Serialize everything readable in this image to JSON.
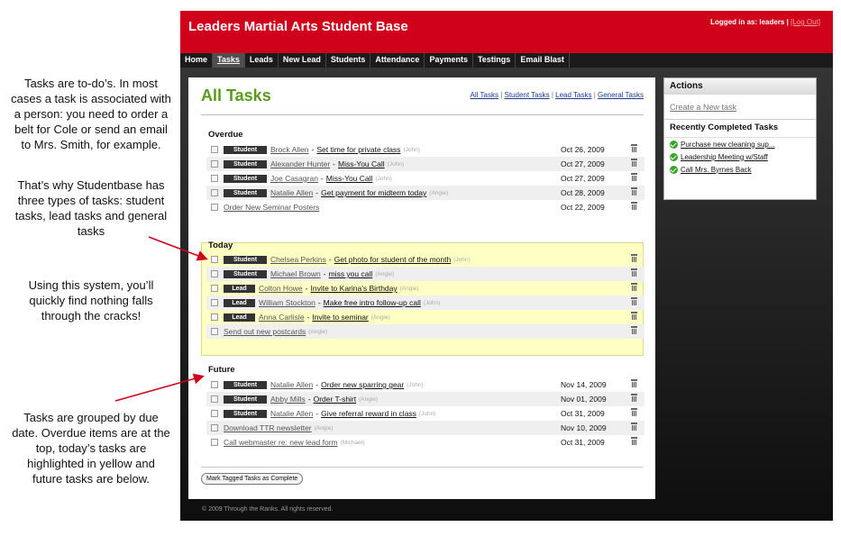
{
  "notes": [
    "Tasks are to-do’s.  In most cases a task is associated with a person:  you need to order a belt for Cole or send an email to Mrs. Smith, for example.",
    "That’s why Studentbase has three types of tasks: student tasks, lead tasks and general tasks",
    "Using this system, you’ll quickly find nothing falls through the cracks!",
    "Tasks are grouped by due date. Overdue items are at the top, today’s tasks are highlighted in yellow and future tasks are below."
  ],
  "header": {
    "title": "Leaders Martial Arts Student Base",
    "logged_in": "Logged in as: leaders |",
    "logout": "[Log Out]"
  },
  "nav": [
    "Home",
    "Tasks",
    "Leads",
    "New Lead",
    "Students",
    "Attendance",
    "Payments",
    "Testings",
    "Email Blast"
  ],
  "main": {
    "title": "All Tasks",
    "filters": [
      "All Tasks",
      "Student Tasks",
      "Lead Tasks",
      "General Tasks"
    ],
    "complete_button": "Mark Tagged Tasks as Complete"
  },
  "overdue": {
    "heading": "Overdue",
    "rows": [
      {
        "type": "Student",
        "person": "Brock Allen",
        "task": "Set time for private class",
        "assignee": "(John)",
        "date": "Oct 26, 2009"
      },
      {
        "type": "Student",
        "person": "Alexander Hunter",
        "task": "Miss-You Call",
        "assignee": "(John)",
        "date": "Oct 27, 2009"
      },
      {
        "type": "Student",
        "person": "Joe Casagran",
        "task": "Miss-You Call",
        "assignee": "(John)",
        "date": "Oct 27, 2009"
      },
      {
        "type": "Student",
        "person": "Natalie Allen",
        "task": "Get payment for midterm today",
        "assignee": "(Angie)",
        "date": "Oct 28, 2009"
      },
      {
        "type": "",
        "person": "",
        "task": "Order New Seminar Posters",
        "assignee": "",
        "date": "Oct 22, 2009"
      }
    ]
  },
  "today": {
    "heading": "Today",
    "rows": [
      {
        "type": "Student",
        "person": "Chelsea Perkins",
        "task": "Get photo for student of the month",
        "assignee": "(John)",
        "date": ""
      },
      {
        "type": "Student",
        "person": "Michael Brown",
        "task": "miss you call",
        "assignee": "(Angie)",
        "date": ""
      },
      {
        "type": "Lead",
        "person": "Colton Howe",
        "task": "Invite to Karina's Birthday",
        "assignee": "(Angie)",
        "date": ""
      },
      {
        "type": "Lead",
        "person": "William Stockton",
        "task": "Make free intro follow-up call",
        "assignee": "(John)",
        "date": ""
      },
      {
        "type": "Lead",
        "person": "Anna Carlisle",
        "task": "Invite to seminar",
        "assignee": "(Angie)",
        "date": ""
      },
      {
        "type": "",
        "person": "",
        "task": "Send out new postcards",
        "assignee": "(Angie)",
        "date": ""
      }
    ]
  },
  "future": {
    "heading": "Future",
    "rows": [
      {
        "type": "Student",
        "person": "Natalie Allen",
        "task": "Order new sparring gear",
        "assignee": "(John)",
        "date": "Nov 14, 2009"
      },
      {
        "type": "Student",
        "person": "Abby Mills",
        "task": "Order T-shirt",
        "assignee": "(Angie)",
        "date": "Nov 01, 2009"
      },
      {
        "type": "Student",
        "person": "Natalie Allen",
        "task": "Give referral reward in class",
        "assignee": "(John)",
        "date": "Oct 31, 2009"
      },
      {
        "type": "",
        "person": "",
        "task": "Download TTR newsletter",
        "assignee": "(Angie)",
        "date": "Nov 10, 2009"
      },
      {
        "type": "",
        "person": "",
        "task": "Call webmaster re: new lead form",
        "assignee": "(Michael)",
        "date": "Oct 31, 2009"
      }
    ]
  },
  "sidebar": {
    "actions_heading": "Actions",
    "create_link": "Create a New task",
    "recent_heading": "Recently Completed Tasks",
    "recent": [
      "Purchase new cleaning sup...",
      "Leadership Meeting w/Staff",
      "Call Mrs. Byrnes Back"
    ]
  },
  "footer": "© 2009 Through the Ranks. All rights reserved."
}
